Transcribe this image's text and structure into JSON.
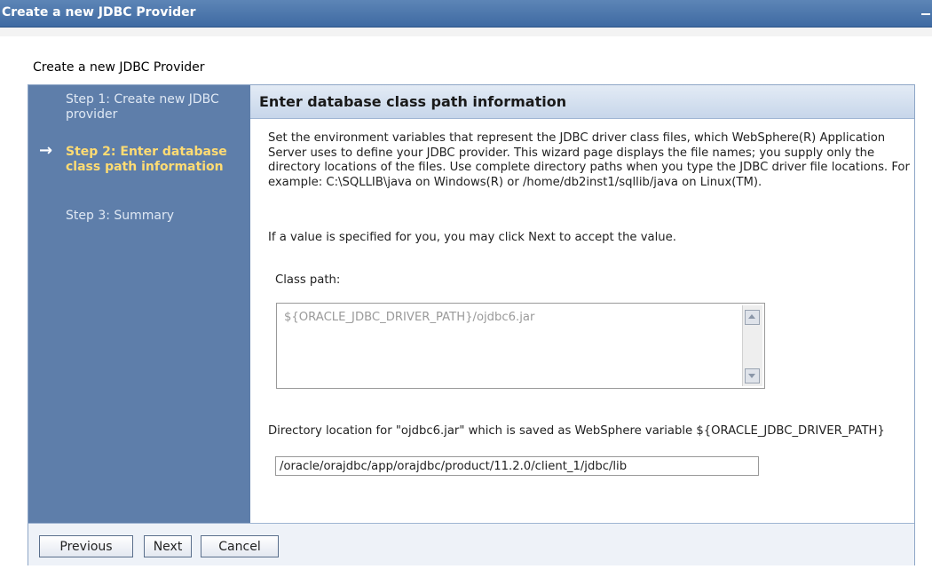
{
  "window": {
    "title": "Create a new JDBC Provider"
  },
  "wizard": {
    "title": "Create a new JDBC Provider",
    "steps": [
      {
        "label": "Step 1: Create new JDBC provider",
        "current": false
      },
      {
        "label": "Step 2: Enter database class path information",
        "current": true
      },
      {
        "label": "Step 3: Summary",
        "current": false
      }
    ],
    "current_step_icon": "arrow-right-icon"
  },
  "panel": {
    "header": "Enter database class path information",
    "description": "Set the environment variables that represent the JDBC driver class files, which WebSphere(R) Application Server uses to define your JDBC provider. This wizard page displays the file names; you supply only the directory locations of the files. Use complete directory paths when you type the JDBC driver file locations. For example: C:\\SQLLIB\\java on Windows(R) or /home/db2inst1/sqllib/java on Linux(TM).",
    "note": "If a value is specified for you, you may click Next to accept the value.",
    "class_path_label": "Class path:",
    "class_path_value": "${ORACLE_JDBC_DRIVER_PATH}/ojdbc6.jar",
    "directory_label": "Directory location for \"ojdbc6.jar\" which is saved as WebSphere variable ${ORACLE_JDBC_DRIVER_PATH}",
    "directory_value": "/oracle/orajdbc/app/orajdbc/product/11.2.0/client_1/jdbc/lib"
  },
  "buttons": {
    "previous": "Previous",
    "next": "Next",
    "cancel": "Cancel"
  },
  "colors": {
    "title_bar": "#4a74aa",
    "steps_background": "#5e7eaa",
    "current_step": "#ffdc73"
  }
}
